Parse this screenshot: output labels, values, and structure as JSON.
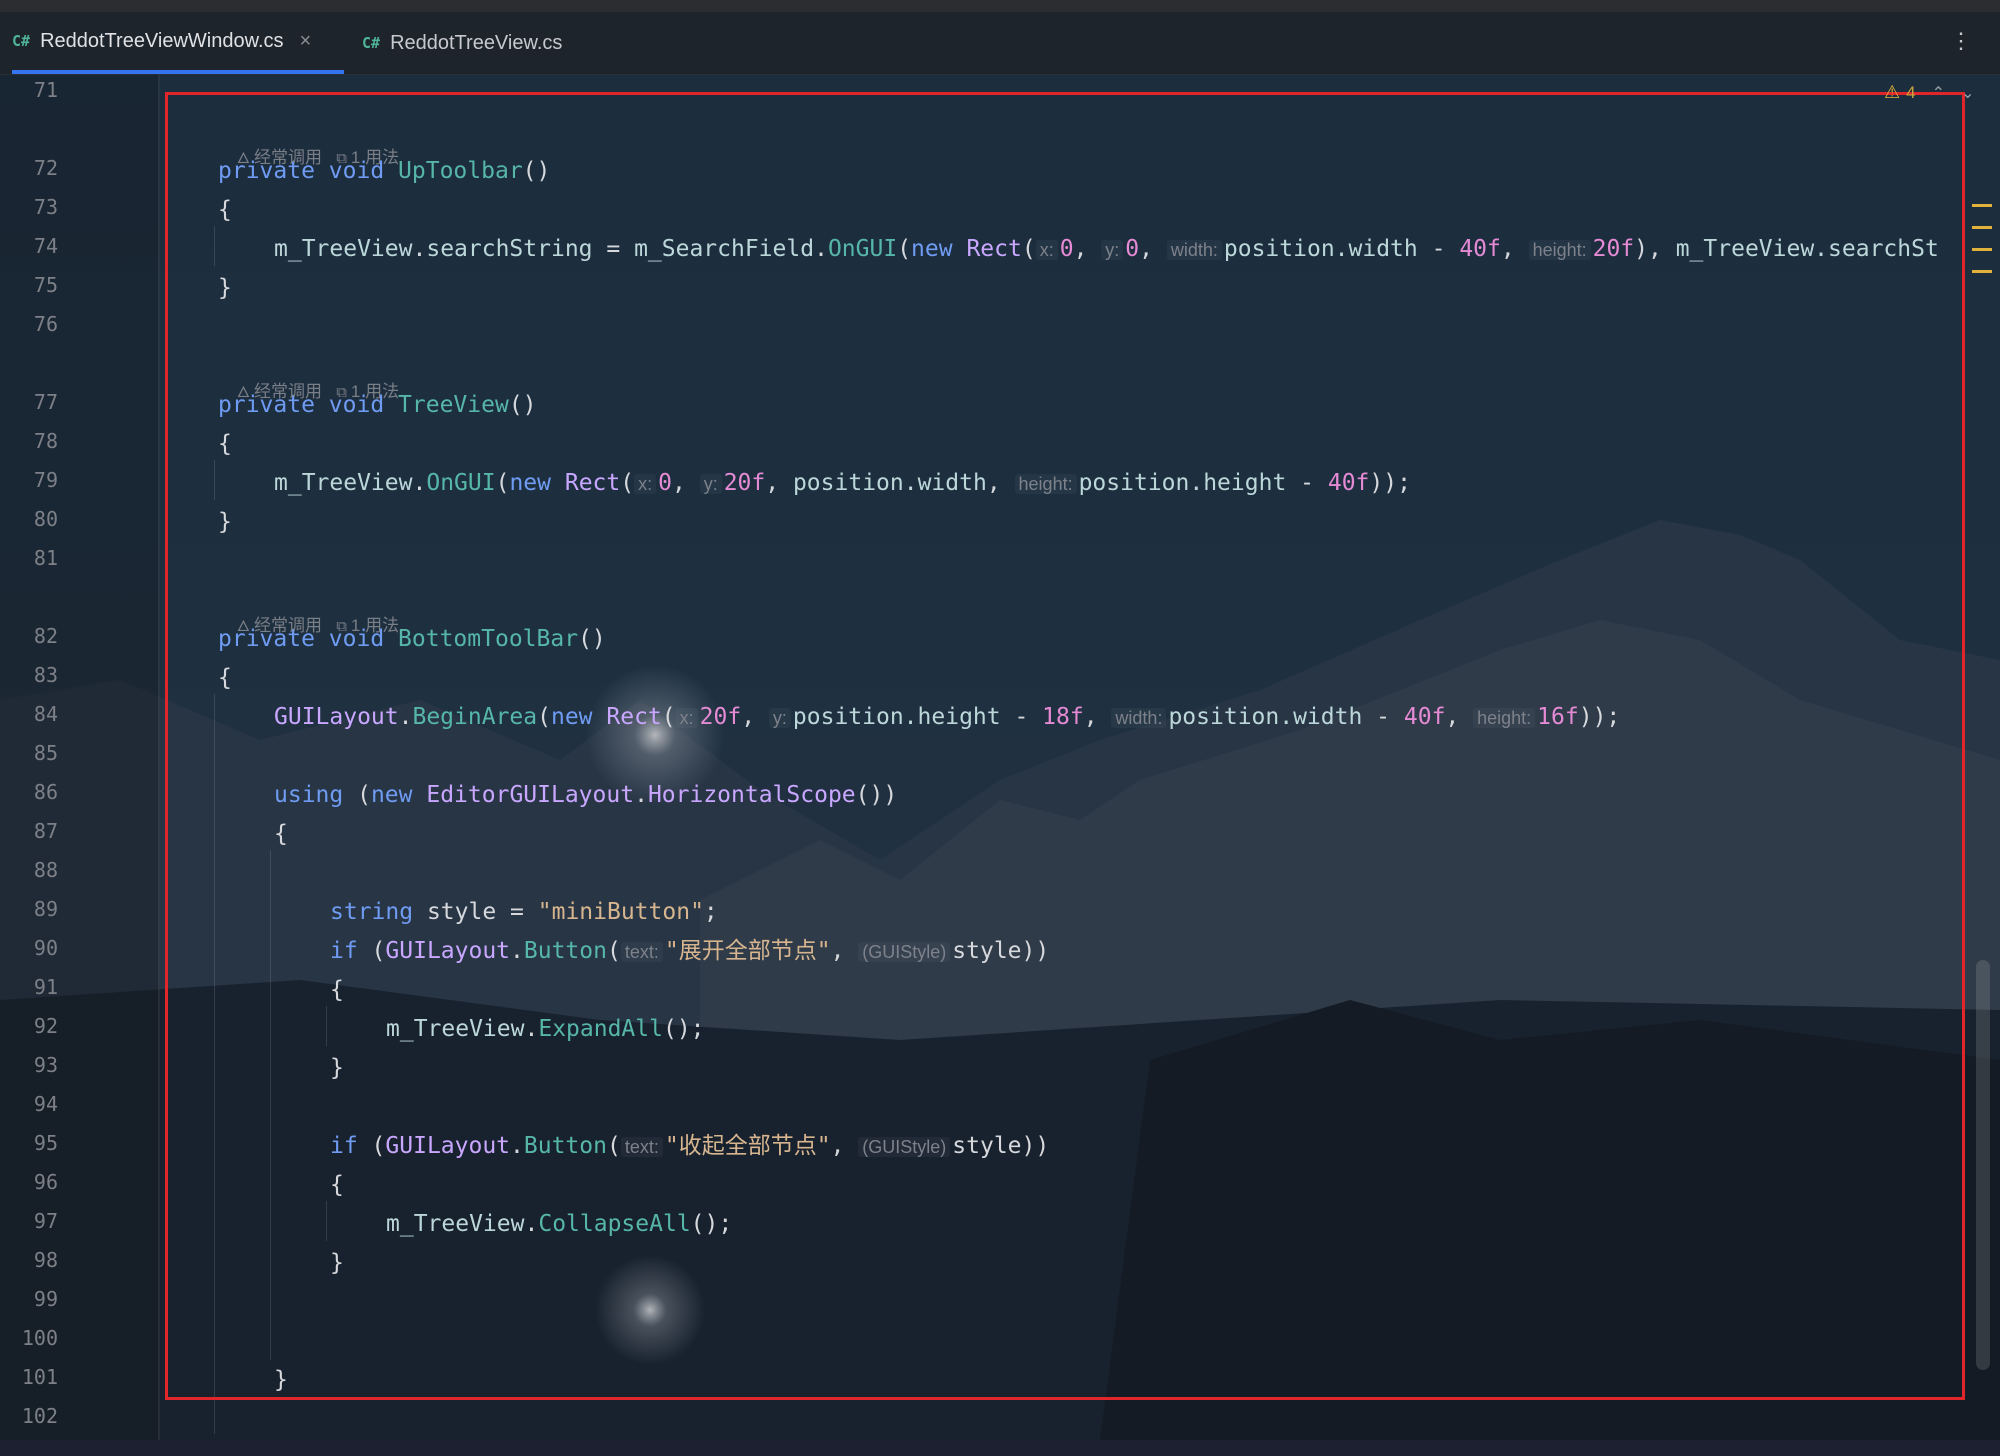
{
  "tabs": [
    {
      "badge": "C#",
      "name": "ReddotTreeViewWindow.cs",
      "close": "×",
      "active": true
    },
    {
      "badge": "C#",
      "name": "ReddotTreeView.cs",
      "active": false
    }
  ],
  "menu_icon": "⋮",
  "inspection": {
    "icon": "warning-icon",
    "warning_symbol": "⚠",
    "count": "4",
    "prev": "⌃",
    "next": "⌄"
  },
  "hint": {
    "usage_freq": "经常调用",
    "usages": "1 用法"
  },
  "line_numbers": [
    "71",
    "72",
    "73",
    "74",
    "75",
    "76",
    "77",
    "78",
    "79",
    "80",
    "81",
    "82",
    "83",
    "84",
    "85",
    "86",
    "87",
    "88",
    "89",
    "90",
    "91",
    "92",
    "93",
    "94",
    "95",
    "96",
    "97",
    "98",
    "99",
    "100",
    "101",
    "102"
  ],
  "code": {
    "private": "private",
    "void": "void",
    "new": "new",
    "using": "using",
    "string": "string",
    "if": "if",
    "open_brace": "{",
    "close_brace": "}",
    "m1": "UpToolbar",
    "m2": "TreeView",
    "m3": "BottomToolBar",
    "parens": "()",
    "tv": "m_TreeView",
    "searchString": "searchString",
    "searchField": "m_SearchField",
    "OnGUI": "OnGUI",
    "Rect": "Rect",
    "GUILayout": "GUILayout",
    "BeginArea": "BeginArea",
    "EditorGUILayout": "EditorGUILayout",
    "HorizontalScope": "HorizontalScope",
    "Button": "Button",
    "ExpandAll": "ExpandAll",
    "CollapseAll": "CollapseAll",
    "style": "style",
    "position_width": "position.width",
    "position_height": "position.height",
    "ph_x": "x:",
    "ph_y": "y:",
    "ph_width": "width:",
    "ph_height": "height:",
    "ph_text": "text:",
    "ph_guistyle": "(GUIStyle)",
    "n0": "0",
    "n20f": "20f",
    "n40f": "40f",
    "n18f": "18f",
    "n16f": "16f",
    "str_minibutton": "\"miniButton\"",
    "str_expand": "\"展开全部节点\"",
    "str_collapse": "\"收起全部节点\"",
    "truncated": "m_TreeView.searchSt"
  }
}
